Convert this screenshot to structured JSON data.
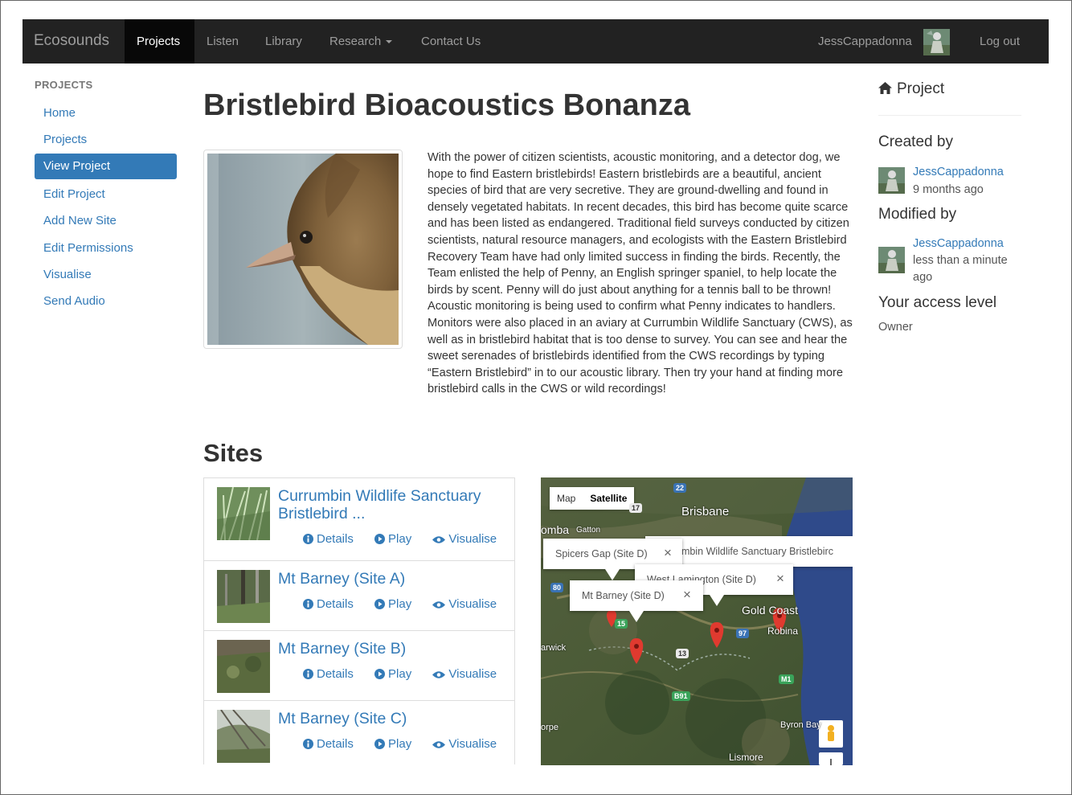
{
  "navbar": {
    "brand": "Ecosounds",
    "items": [
      {
        "label": "Projects",
        "active": true
      },
      {
        "label": "Listen"
      },
      {
        "label": "Library"
      },
      {
        "label": "Research"
      },
      {
        "label": "Contact Us"
      }
    ],
    "user": "JessCappadonna",
    "logout": "Log out"
  },
  "sidebar": {
    "heading": "PROJECTS",
    "items": [
      {
        "label": "Home"
      },
      {
        "label": "Projects"
      },
      {
        "label": "View Project",
        "active": true
      },
      {
        "label": "Edit Project"
      },
      {
        "label": "Add New Site"
      },
      {
        "label": "Edit Permissions"
      },
      {
        "label": "Visualise"
      },
      {
        "label": "Send Audio"
      }
    ]
  },
  "project": {
    "title": "Bristlebird Bioacoustics Bonanza",
    "description": "With the power of citizen scientists, acoustic monitoring, and a detector dog, we hope to find Eastern bristlebirds! Eastern bristlebirds are a beautiful, ancient species of bird that are very secretive. They are ground-dwelling and found in densely vegetated habitats. In recent decades, this bird has become quite scarce and has been listed as endangered. Traditional field surveys conducted by citizen scientists, natural resource managers, and ecologists with the Eastern Bristlebird Recovery Team have had only limited success in finding the birds. Recently, the Team enlisted the help of Penny, an English springer spaniel, to help locate the birds by scent. Penny will do just about anything for a tennis ball to be thrown! Acoustic monitoring is being used to confirm what Penny indicates to handlers. Monitors were also placed in an aviary at Currumbin Wildlife Sanctuary (CWS), as well as in bristlebird habitat that is too dense to survey. You can see and hear the sweet serenades of bristlebirds identified from the CWS recordings by typing “Eastern Bristlebird” in to our acoustic library. Then try your hand at finding more bristlebird calls in the CWS or wild recordings!"
  },
  "sites": {
    "heading": "Sites",
    "actions": {
      "details": "Details",
      "play": "Play",
      "visualise": "Visualise"
    },
    "items": [
      {
        "name_line1": "Currumbin Wildlife Sanctuary",
        "name_line2": "Bristlebird ..."
      },
      {
        "name_line1": "Mt Barney (Site A)"
      },
      {
        "name_line1": "Mt Barney (Site B)"
      },
      {
        "name_line1": "Mt Barney (Site C)"
      }
    ]
  },
  "map": {
    "controls": {
      "map": "Map",
      "satellite": "Satellite",
      "selected": "Satellite"
    },
    "labels": {
      "brisbane": "Brisbane",
      "gatton": "Gatton",
      "omba": "omba",
      "gold_coast": "Gold Coast",
      "robina": "Robina",
      "warwick": "arwick",
      "byron_bay": "Byron Bay",
      "lismore": "Lismore",
      "orpe": "orpe"
    },
    "shields": [
      "22",
      "17",
      "80",
      "15",
      "13",
      "97",
      "M1",
      "B91"
    ],
    "infowindows": [
      {
        "text": "Spicers Gap (Site D)"
      },
      {
        "text": "mbin Wildlife Sanctuary Bristlebirc"
      },
      {
        "text": "West Lamington (Site D)"
      },
      {
        "text": "Mt Barney (Site D)"
      }
    ]
  },
  "right_sidebar": {
    "heading": "Project",
    "created_by_label": "Created by",
    "created_by_user": "JessCappadonna",
    "created_time": "9 months ago",
    "modified_by_label": "Modified by",
    "modified_by_user": "JessCappadonna",
    "modified_time": "less than a minute ago",
    "access_label": "Your access level",
    "access_value": "Owner"
  },
  "colors": {
    "navbar_bg": "#222222",
    "link": "#337ab7",
    "active_bg": "#337ab7"
  }
}
